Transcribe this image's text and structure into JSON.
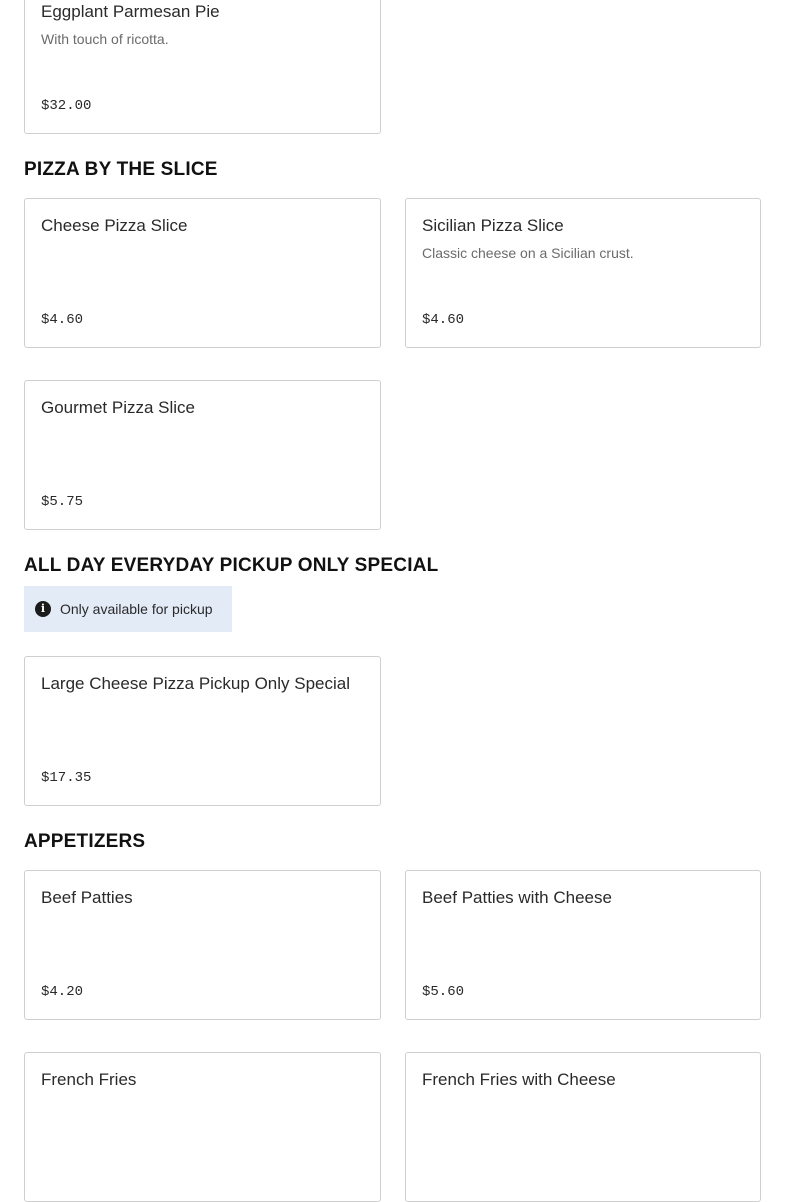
{
  "sections": [
    {
      "title": "",
      "items": [
        {
          "name": "Eggplant Parmesan Pie",
          "description": "With touch of ricotta.",
          "price": "$32.00"
        }
      ]
    },
    {
      "title": "PIZZA BY THE SLICE",
      "items": [
        {
          "name": "Cheese Pizza Slice",
          "description": "",
          "price": "$4.60"
        },
        {
          "name": "Sicilian Pizza Slice",
          "description": "Classic cheese on a Sicilian crust.",
          "price": "$4.60"
        },
        {
          "name": "Gourmet Pizza Slice",
          "description": "",
          "price": "$5.75"
        }
      ]
    },
    {
      "title": "ALL DAY EVERYDAY PICKUP ONLY SPECIAL",
      "notice": {
        "icon": "info-icon",
        "text": "Only available for pickup"
      },
      "items": [
        {
          "name": "Large Cheese Pizza Pickup Only Special",
          "description": "",
          "price": "$17.35"
        }
      ]
    },
    {
      "title": "APPETIZERS",
      "items": [
        {
          "name": "Beef Patties",
          "description": "",
          "price": "$4.20"
        },
        {
          "name": "Beef Patties with Cheese",
          "description": "",
          "price": "$5.60"
        },
        {
          "name": "French Fries",
          "description": "",
          "price": ""
        },
        {
          "name": "French Fries with Cheese",
          "description": "",
          "price": ""
        }
      ]
    }
  ],
  "colors": {
    "notice_background": "#e3ebf7",
    "card_border": "#cfcfcf",
    "description_text": "#6b6b6b"
  }
}
